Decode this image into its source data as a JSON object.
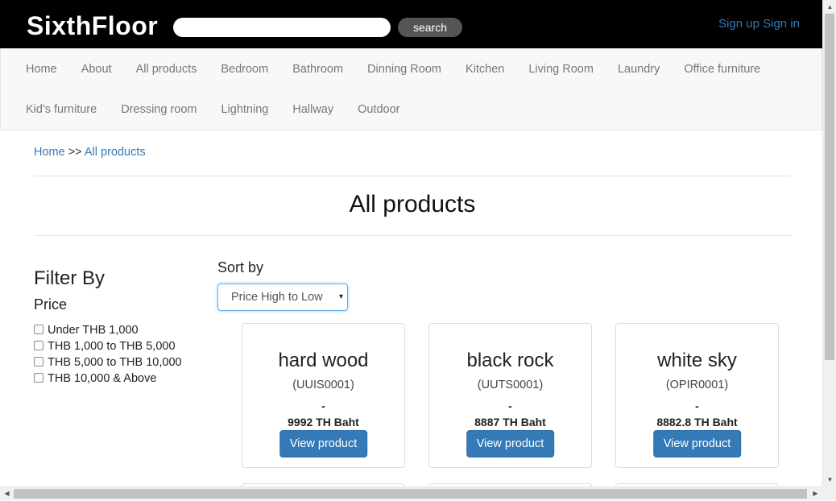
{
  "header": {
    "logo": "SixthFloor",
    "search_placeholder": "",
    "search_button": "search",
    "signup": "Sign up",
    "signin": "Sign in"
  },
  "nav": {
    "row1": [
      "Home",
      "About",
      "All products",
      "Bedroom",
      "Bathroom",
      "Dinning Room",
      "Kitchen",
      "Living Room",
      "Laundry",
      "Office furniture"
    ],
    "row2": [
      "Kid's furniture",
      "Dressing room",
      "Lightning",
      "Hallway",
      "Outdoor"
    ]
  },
  "breadcrumb": {
    "home": "Home",
    "separator": ">>",
    "current": "All products"
  },
  "page_title": "All products",
  "filter": {
    "title": "Filter By",
    "subtitle": "Price",
    "options": [
      "Under THB 1,000",
      "THB 1,000 to THB 5,000",
      "THB 5,000 to THB 10,000",
      "THB 10,000 & Above"
    ]
  },
  "sort": {
    "label": "Sort by",
    "selected": "Price High to Low",
    "caret": "▾"
  },
  "products": [
    {
      "name": "hard wood",
      "code": "(UUIS0001)",
      "dash": "-",
      "price": "9992 TH Baht",
      "button": "View product"
    },
    {
      "name": "black rock",
      "code": "(UUTS0001)",
      "dash": "-",
      "price": "8887 TH Baht",
      "button": "View product"
    },
    {
      "name": "white sky",
      "code": "(OPIR0001)",
      "dash": "-",
      "price": "8882.8 TH Baht",
      "button": "View product"
    }
  ],
  "scrollbar": {
    "up": "▲",
    "down": "▼",
    "left": "◀",
    "right": "▶"
  }
}
